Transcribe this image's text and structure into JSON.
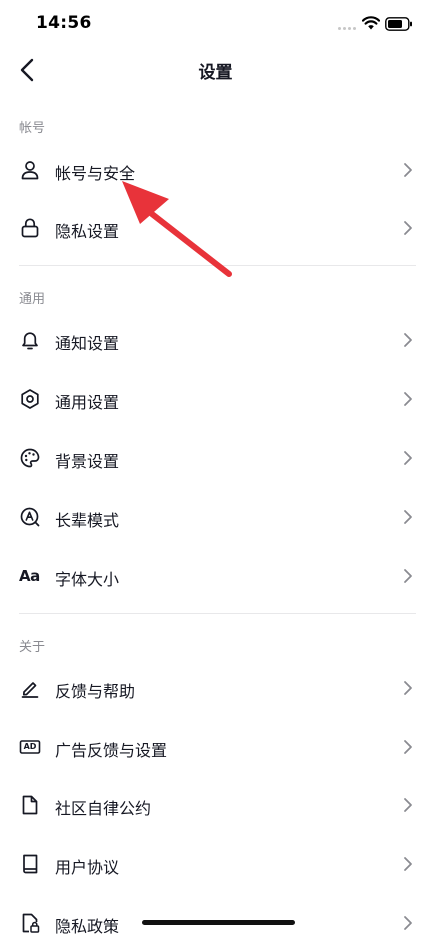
{
  "status_bar": {
    "time": "14:56",
    "icons": [
      "signal-dots-icon",
      "wifi-icon",
      "battery-icon"
    ]
  },
  "nav": {
    "title": "设置",
    "back_icon": "chevron-left-icon"
  },
  "sections": [
    {
      "label": "帐号",
      "items": [
        {
          "label": "帐号与安全",
          "icon": "user-icon"
        },
        {
          "label": "隐私设置",
          "icon": "lock-icon"
        }
      ]
    },
    {
      "label": "通用",
      "items": [
        {
          "label": "通知设置",
          "icon": "bell-icon"
        },
        {
          "label": "通用设置",
          "icon": "gear-icon"
        },
        {
          "label": "背景设置",
          "icon": "palette-icon"
        },
        {
          "label": "长辈模式",
          "icon": "elder-mode-icon"
        },
        {
          "label": "字体大小",
          "icon": "font-size-icon",
          "icon_text": "Aa"
        }
      ]
    },
    {
      "label": "关于",
      "items": [
        {
          "label": "反馈与帮助",
          "icon": "edit-icon"
        },
        {
          "label": "广告反馈与设置",
          "icon": "ad-icon",
          "icon_text": "AD"
        },
        {
          "label": "社区自律公约",
          "icon": "document-icon"
        },
        {
          "label": "用户协议",
          "icon": "book-icon"
        },
        {
          "label": "隐私政策",
          "icon": "privacy-document-icon"
        }
      ]
    }
  ],
  "row_chevron_icon": "chevron-right-icon",
  "annotation": {
    "icon": "red-arrow-annotation",
    "color": "#e8333a"
  },
  "colors": {
    "text": "#161823",
    "secondary": "#8a8b91",
    "divider": "#e8e8ea",
    "arrow": "#e8333a"
  }
}
